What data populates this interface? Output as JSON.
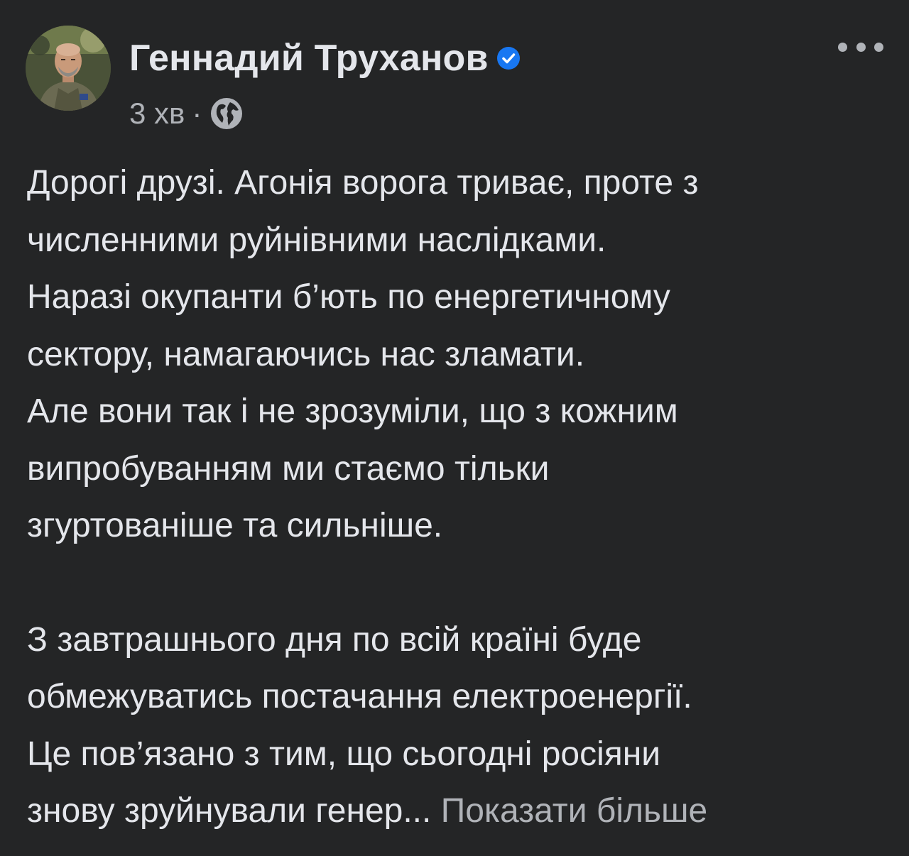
{
  "post": {
    "author_name": "Геннадий Труханов",
    "verified_icon": "verified-badge-icon",
    "timestamp": "3 хв",
    "separator": "·",
    "audience_icon": "globe-icon",
    "more_icon": "more-horizontal-icon",
    "paragraph1": [
      "Дорогі друзі. Агонія ворога триває, проте з",
      "численними руйнівними наслідками.",
      "Наразі окупанти б’ють по енергетичному",
      "сектору, намагаючись нас зламати.",
      "Але вони так і не зрозуміли, що з кожним",
      "випробуванням ми стаємо тільки",
      "згуртованіше та сильніше."
    ],
    "paragraph2": [
      "З завтрашнього дня по всій країні буде",
      "обмежуватись постачання електроенергії.",
      "Це пов’язано з тим, що сьогодні росіяни"
    ],
    "last_line_text": "знову зруйнували генер...",
    "see_more_label": "Показати більше"
  },
  "colors": {
    "background": "#242526",
    "primary_text": "#e4e6eb",
    "secondary_text": "#b0b3b8",
    "verified_blue": "#1877f2"
  }
}
